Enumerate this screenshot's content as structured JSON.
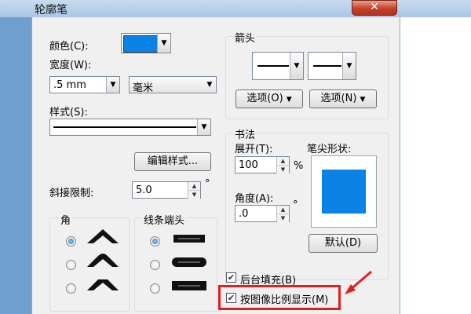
{
  "window": {
    "title": "轮廓笔",
    "close_glyph": "✕"
  },
  "color": {
    "label": "颜色(C):",
    "swatch": "#0a82e6"
  },
  "width": {
    "label": "宽度(W):",
    "value": ".5 mm",
    "unit": "毫米"
  },
  "style": {
    "label": "样式(S):",
    "edit_button": "编辑样式..."
  },
  "miter": {
    "label": "斜接限制:",
    "value": "5.0",
    "unit": "°"
  },
  "corners": {
    "title": "角",
    "selected_index": 0
  },
  "line_caps": {
    "title": "线条端头",
    "selected_index": 0
  },
  "arrows": {
    "title": "箭头",
    "left_option": "选项(O)",
    "right_option": "选项(N)"
  },
  "calligraphy": {
    "title": "书法",
    "stretch_label": "展开(T):",
    "stretch_value": "100",
    "stretch_unit": "%",
    "angle_label": "角度(A):",
    "angle_value": ".0",
    "angle_unit": "°",
    "nib_label": "笔尖形状:",
    "nib_color": "#0a82e6",
    "default_button": "默认(D)"
  },
  "options": {
    "behind_fill": {
      "label": "后台填充(B)",
      "checked": true
    },
    "scale_with_image": {
      "label": "按图像比例显示(M)",
      "checked": true
    }
  },
  "annotation": {
    "highlight_color": "#e02020"
  },
  "icons": {
    "dropdown": "▼",
    "spin_up": "▲",
    "spin_down": "▼",
    "check": "✔",
    "nib_square": "square-nib-preview",
    "red_arrow": "pointer-arrow"
  }
}
